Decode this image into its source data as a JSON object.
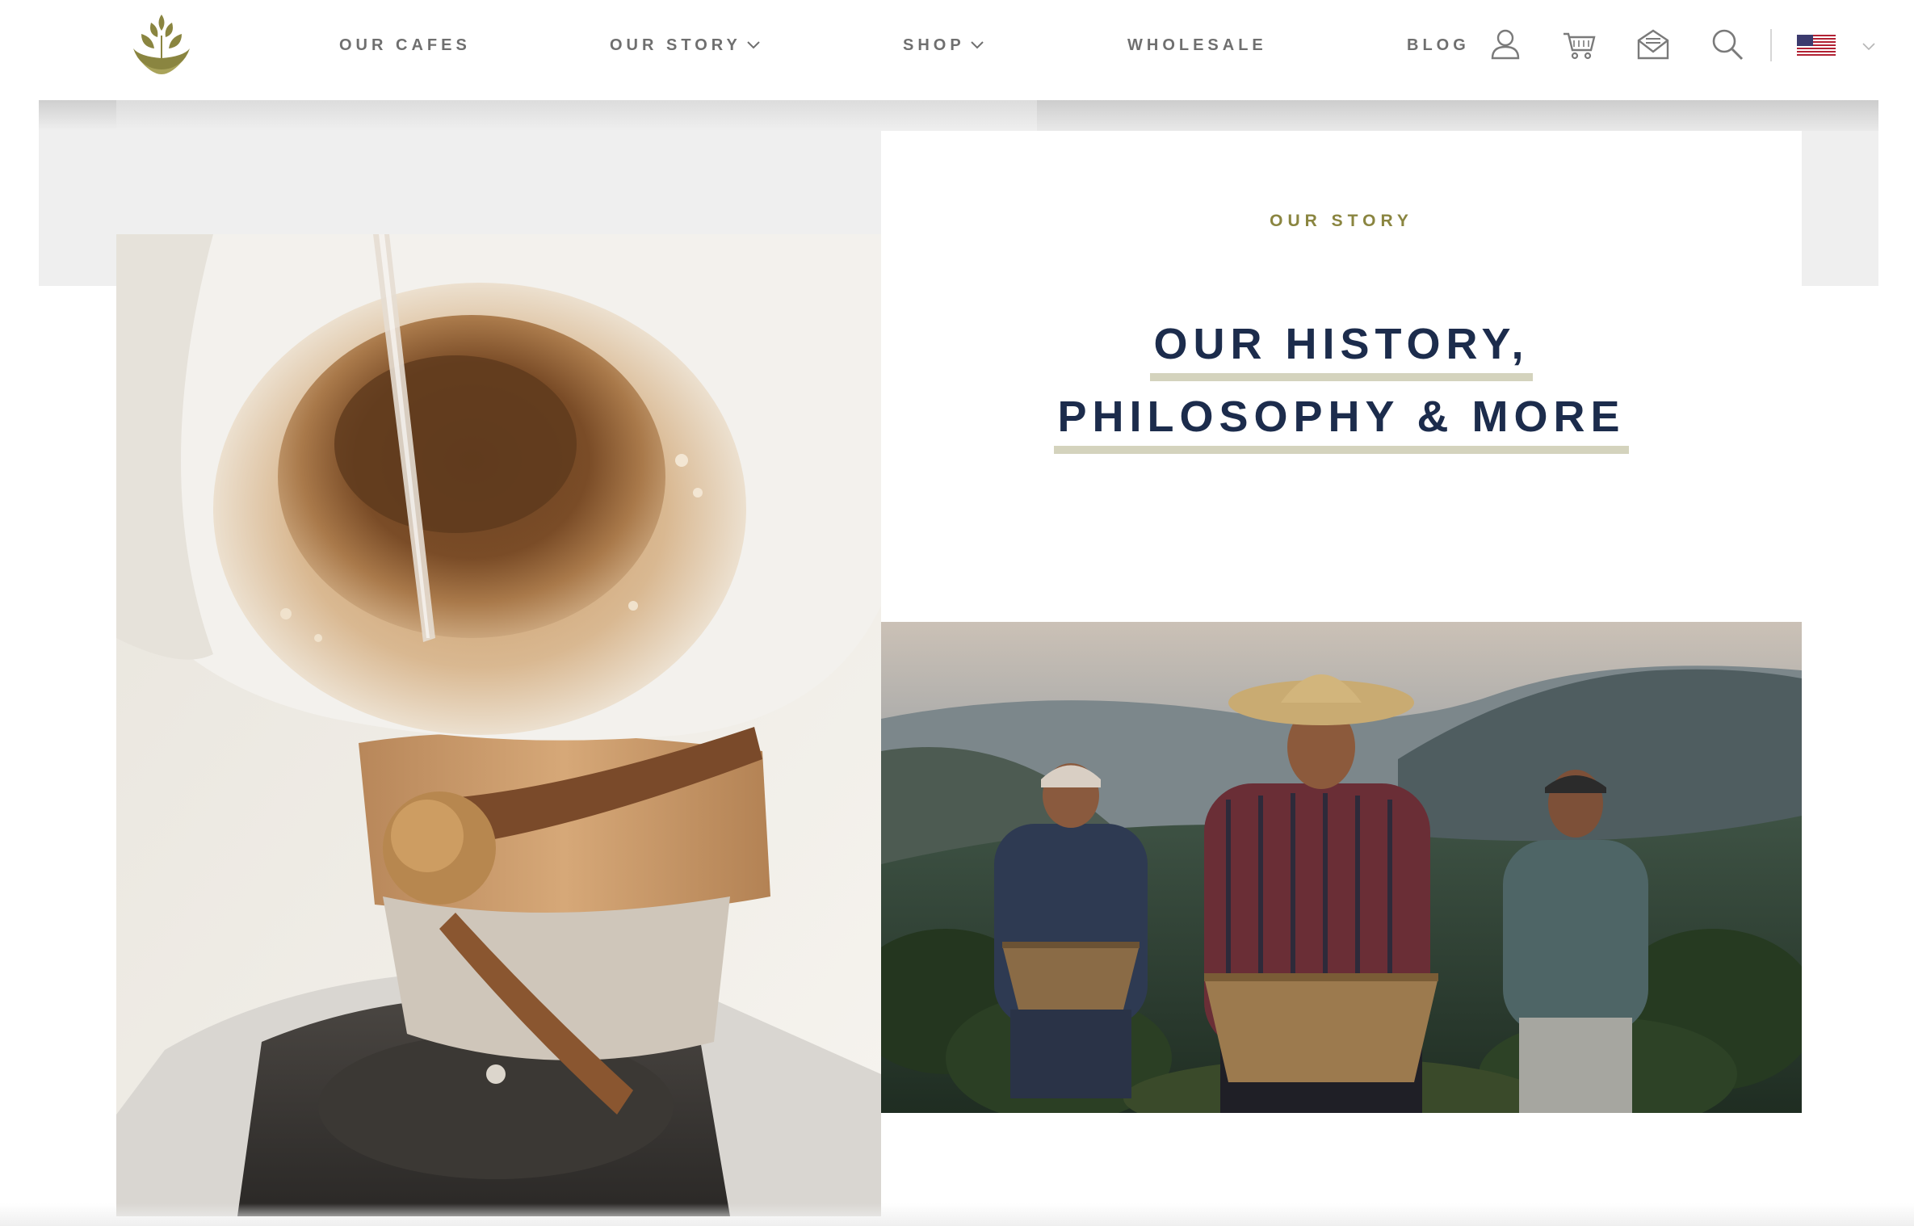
{
  "header": {
    "logo_icon": "coffee-plant-logo-icon",
    "nav": [
      {
        "label": "OUR CAFES",
        "has_dropdown": false
      },
      {
        "label": "OUR STORY",
        "has_dropdown": true
      },
      {
        "label": "SHOP",
        "has_dropdown": true
      },
      {
        "label": "WHOLESALE",
        "has_dropdown": false
      },
      {
        "label": "BLOG",
        "has_dropdown": false
      }
    ],
    "icons": [
      "user-icon",
      "cart-icon",
      "mail-icon",
      "search-icon"
    ],
    "locale_flag": "us-flag-icon"
  },
  "hero": {
    "eyebrow": "OUR STORY",
    "headline_line1": "OUR HISTORY,",
    "headline_line2": "PHILOSOPHY & MORE"
  },
  "images": {
    "left": "chemex-pour-over-photo",
    "right": "coffee-farmers-photo"
  },
  "colors": {
    "nav_text": "#6f6f6f",
    "eyebrow": "#8a8540",
    "headline": "#1c2c4c",
    "underline": "#d4d3bd",
    "logo": "#8a8540",
    "band": "#efefef"
  }
}
